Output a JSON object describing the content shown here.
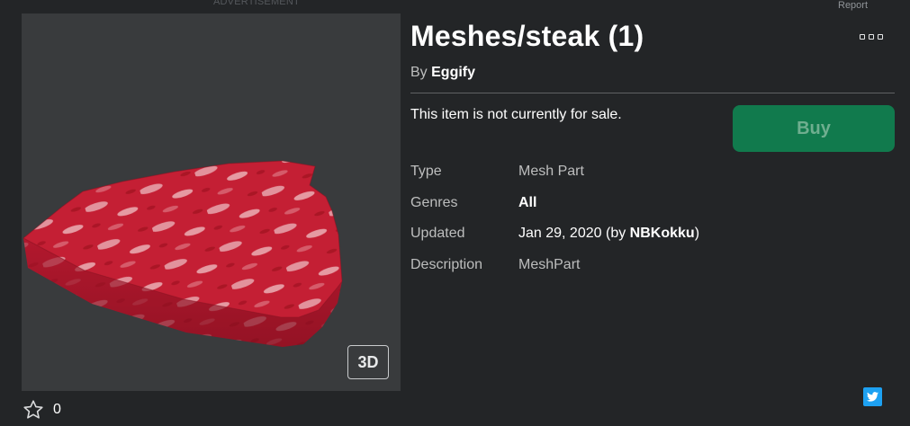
{
  "ad": {
    "label": "ADVERTISEMENT"
  },
  "report": {
    "label": "Report"
  },
  "item": {
    "title": "Meshes/steak (1)",
    "by_prefix": "By",
    "creator": "Eggify",
    "sale_message": "This item is not currently for sale.",
    "buy_label": "Buy",
    "view_3d_label": "3D",
    "favorites_count": "0"
  },
  "details": {
    "type_label": "Type",
    "type_value": "Mesh Part",
    "genres_label": "Genres",
    "genres_value": "All",
    "updated_label": "Updated",
    "updated_date": "Jan 29, 2020",
    "updated_by_prefix": "(by",
    "updated_by_user": "NBKokku",
    "updated_by_suffix": ")",
    "description_label": "Description",
    "description_value": "MeshPart"
  },
  "icons": {
    "more": "ellipsis-icon",
    "favorite": "star-outline-icon",
    "share": "twitter-icon"
  },
  "colors": {
    "background": "#232527",
    "thumbnail_bg": "#393b3d",
    "buy_button": "#117a4d",
    "twitter": "#1da1f2"
  }
}
